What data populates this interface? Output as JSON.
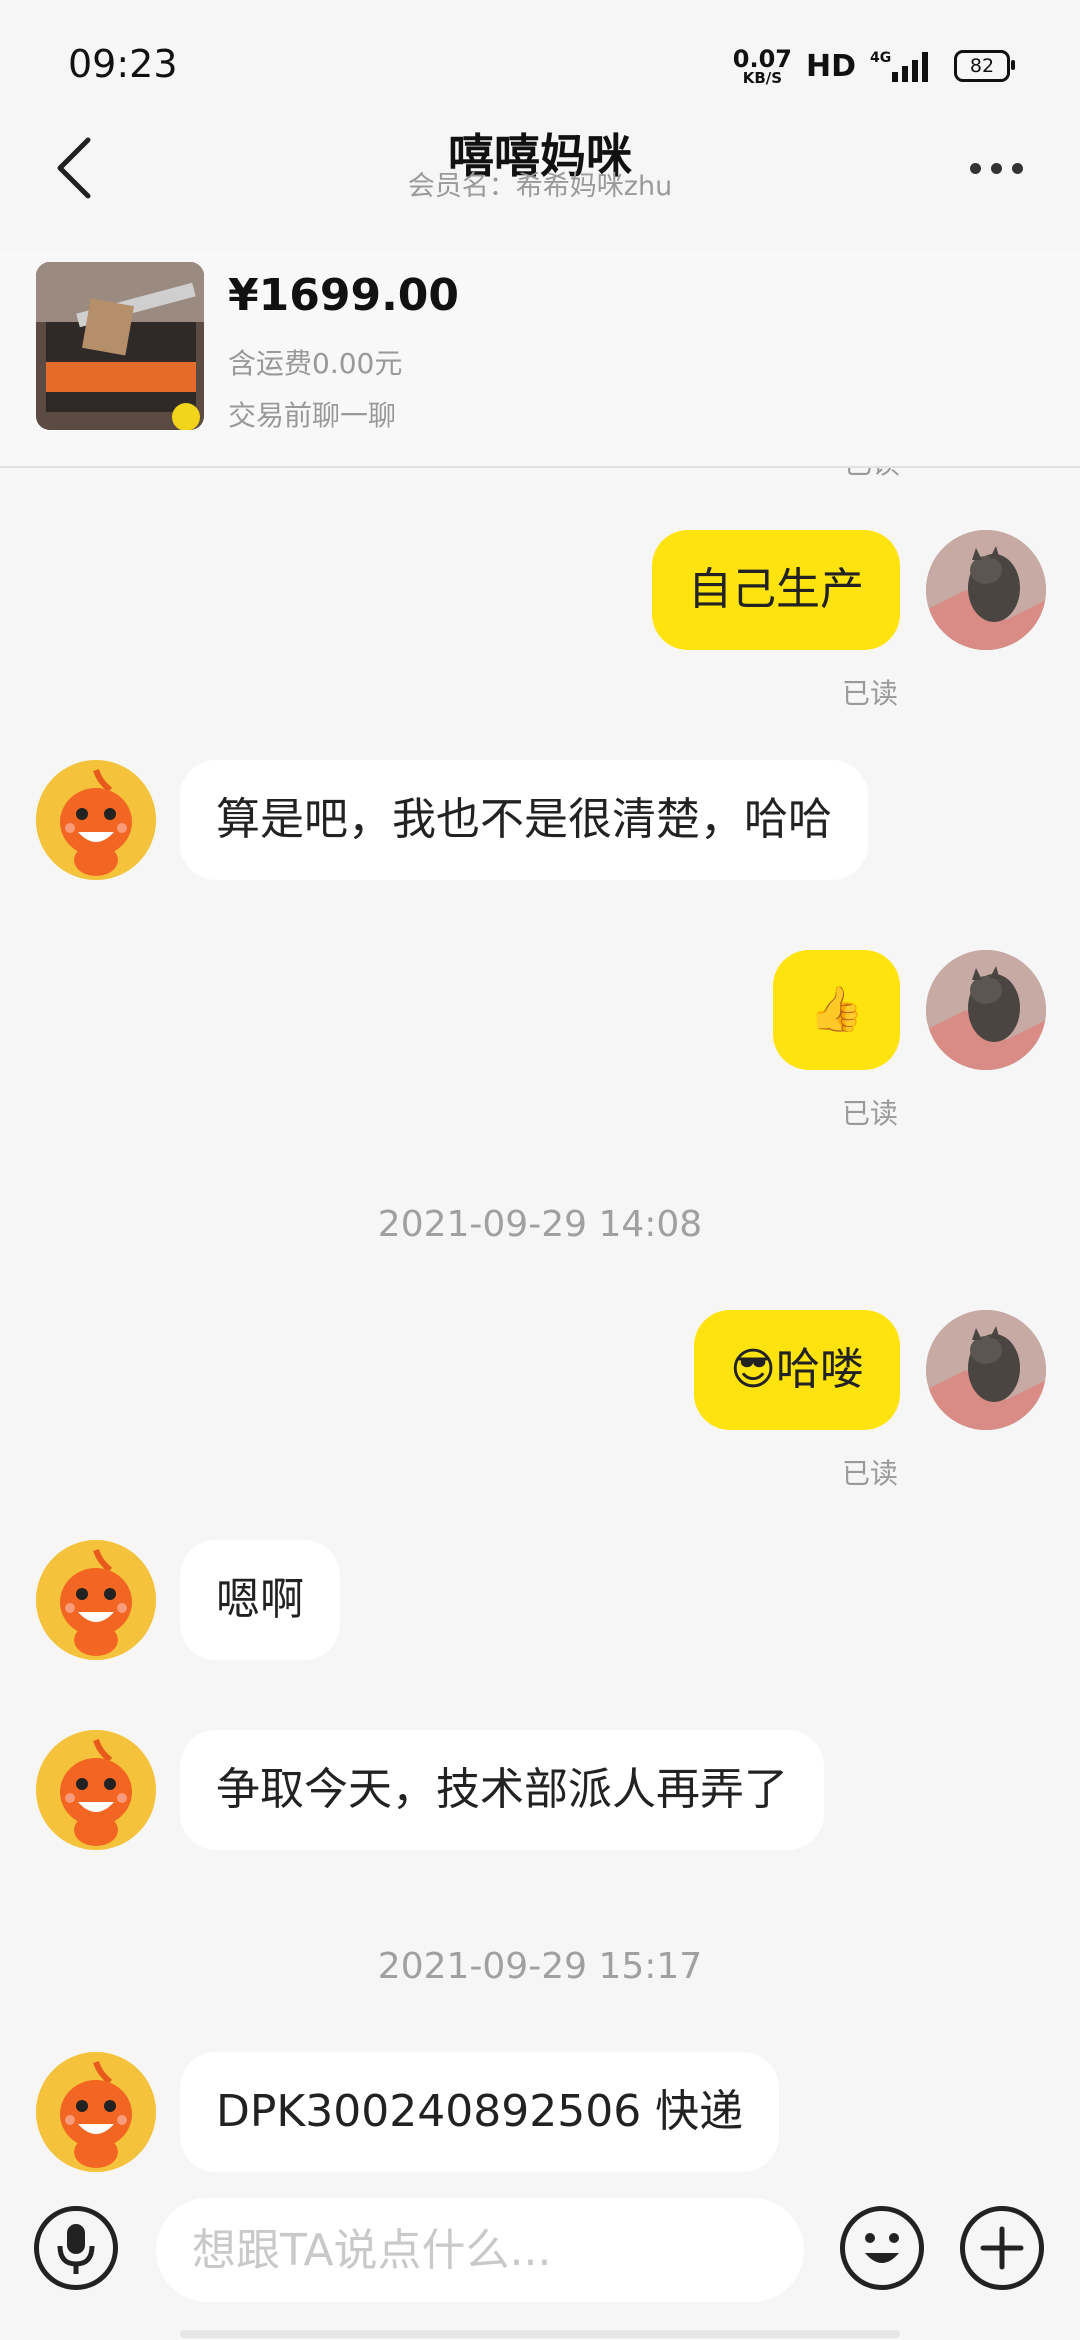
{
  "status_bar": {
    "time": "09:23",
    "net_speed": "0.07",
    "net_unit": "KB/S",
    "hd": "HD",
    "signal": "4G",
    "battery": "82"
  },
  "header": {
    "title": "嘻嘻妈咪",
    "subtitle": "会员名：希希妈咪zhu",
    "back_icon": "chevron-left-icon",
    "more_icon": "more-dots-icon"
  },
  "product": {
    "price": "¥1699.00",
    "shipping": "含运费0.00元",
    "chat_before": "交易前聊一聊"
  },
  "messages": [
    {
      "side": "mine",
      "text": "自己生产",
      "read": "已读"
    },
    {
      "side": "theirs",
      "text": "算是吧，我也不是很清楚，哈哈"
    },
    {
      "side": "mine",
      "text": "👍",
      "read": "已读"
    },
    {
      "type": "time",
      "text": "2021-09-29 14:08"
    },
    {
      "side": "mine",
      "text": "😎哈喽",
      "read": "已读"
    },
    {
      "side": "theirs",
      "text": "嗯啊"
    },
    {
      "side": "theirs",
      "text": "争取今天，技术部派人再弄了"
    },
    {
      "type": "time",
      "text": "2021-09-29 15:17"
    },
    {
      "side": "theirs",
      "text": "DPK300240892506  快递"
    }
  ],
  "input_bar": {
    "placeholder": "想跟TA说点什么...",
    "mic_icon": "microphone-icon",
    "emoji_icon": "smiley-icon",
    "plus_icon": "plus-icon"
  },
  "colors": {
    "accent_yellow": "#ffe30f",
    "background": "#f6f6f6",
    "mascot_orange": "#f26522"
  }
}
